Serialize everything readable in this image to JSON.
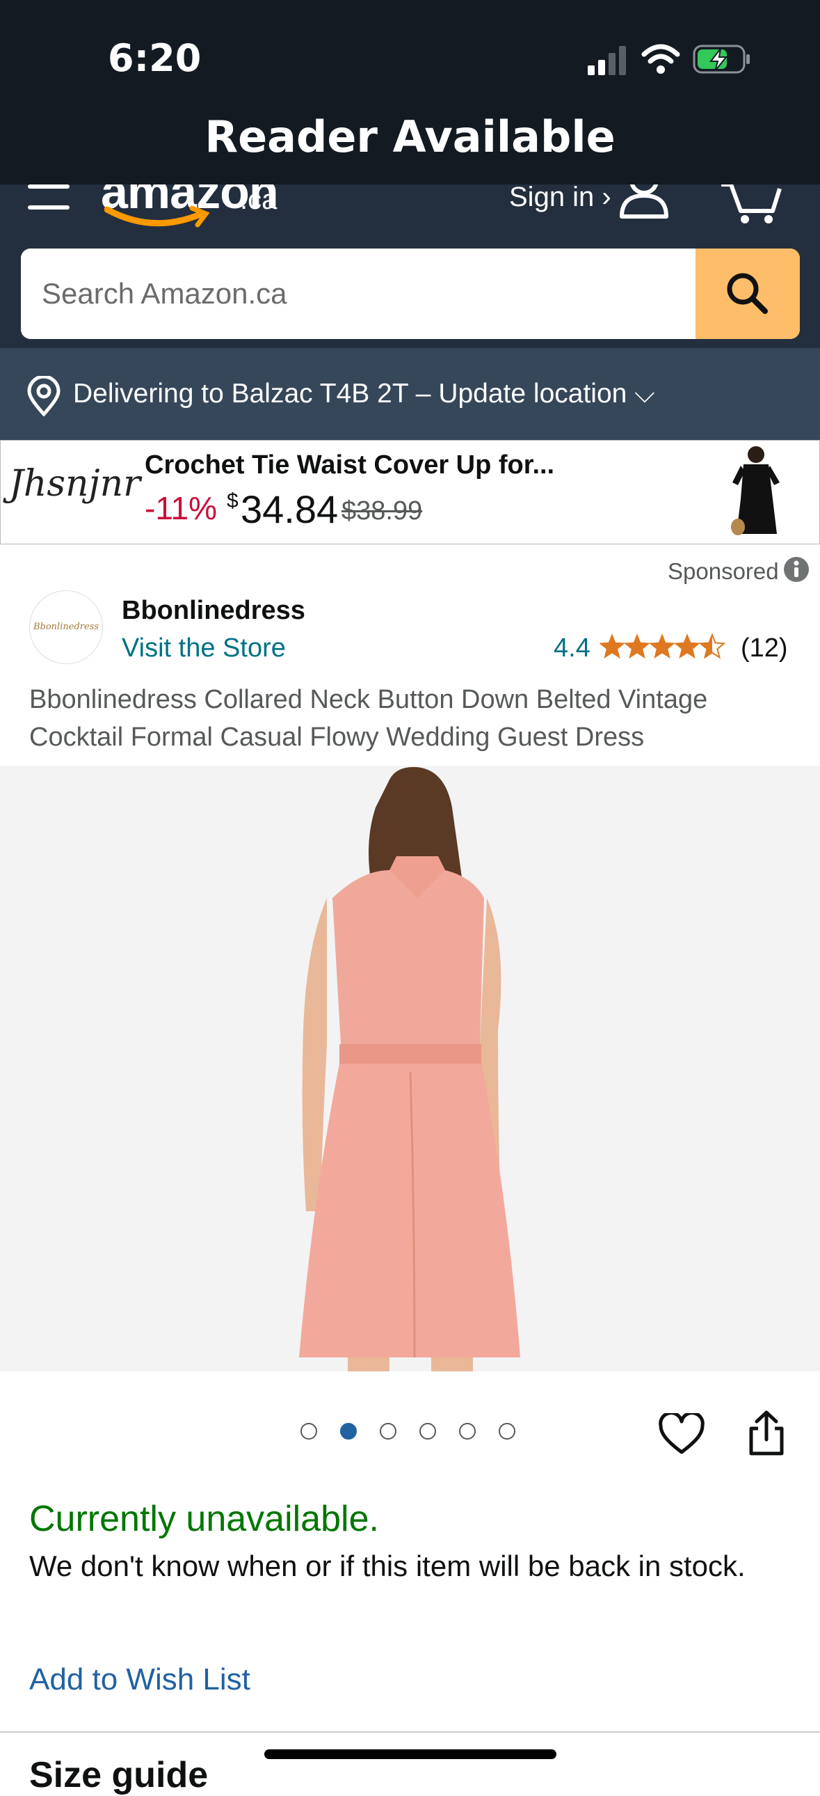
{
  "status_bar": {
    "time": "6:20",
    "banner": "Reader Available"
  },
  "header": {
    "logo_text": "amazon",
    "logo_suffix": ".ca",
    "sign_in": "Sign in ›",
    "search_placeholder": "Search Amazon.ca"
  },
  "delivery": {
    "text": "Delivering to Balzac T4B 2T – Update location ⌵"
  },
  "ad": {
    "brand": "Jhsnjnr",
    "title": "Crochet Tie Waist Cover Up for...",
    "discount": "-11%",
    "currency": "$",
    "price": "34.84",
    "original_price": "$38.99"
  },
  "product": {
    "sponsored": "Sponsored",
    "brand_name": "Bbonlinedress",
    "brand_logo_text": "Bbonlinedress",
    "visit_store": "Visit the Store",
    "rating": "4.4",
    "rating_value": 4.4,
    "rating_count": "(12)",
    "title": "Bbonlinedress Collared Neck Button Down Belted Vintage Cocktail Formal Casual Flowy Wedding Guest Dress",
    "image_count": 6,
    "active_image": 2
  },
  "availability": {
    "status": "Currently unavailable.",
    "message": "We don't know when or if this item will be back in stock.",
    "wishlist": "Add to Wish List"
  },
  "next_section": "Size guide",
  "colors": {
    "header_bg": "#232f3e",
    "status_bg": "#131a22",
    "delivery_bg": "#37475a",
    "search_button": "#febd69",
    "link": "#2162a1",
    "available_green": "#007600",
    "star": "#de7921",
    "discount_red": "#cc0c39"
  }
}
